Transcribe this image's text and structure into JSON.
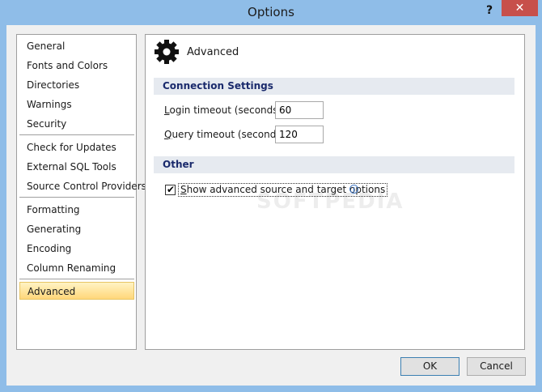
{
  "window": {
    "title": "Options",
    "help_label": "?",
    "close_label": "✕"
  },
  "nav": {
    "items": [
      {
        "label": "General"
      },
      {
        "label": "Fonts and Colors"
      },
      {
        "label": "Directories"
      },
      {
        "label": "Warnings"
      },
      {
        "label": "Security"
      },
      {
        "label": "Check for Updates"
      },
      {
        "label": "External SQL Tools"
      },
      {
        "label": "Source Control Providers"
      },
      {
        "label": "Formatting"
      },
      {
        "label": "Generating"
      },
      {
        "label": "Encoding"
      },
      {
        "label": "Column Renaming"
      },
      {
        "label": "Advanced"
      }
    ],
    "selected": "Advanced"
  },
  "panel": {
    "title": "Advanced",
    "icon": "gear-icon",
    "connection": {
      "header": "Connection Settings",
      "login_label_key": "L",
      "login_label_rest": "ogin timeout (seconds)",
      "login_value": "60",
      "query_label_key": "Q",
      "query_label_rest": "uery timeout (seconds)",
      "query_value": "120"
    },
    "other": {
      "header": "Other",
      "show_advanced_key": "S",
      "show_advanced_rest": "how advanced source and target options",
      "show_advanced_checked": true,
      "check_glyph": "✔",
      "info_glyph": "i"
    }
  },
  "watermark": "SOFTPEDIA",
  "buttons": {
    "ok": "OK",
    "cancel": "Cancel"
  },
  "colors": {
    "selected_item": "#ffd77a",
    "section_header_bg": "#e6eaf0",
    "section_header_text": "#1a2a6c",
    "close_button": "#c7504b",
    "frame": "#8fbde8"
  }
}
